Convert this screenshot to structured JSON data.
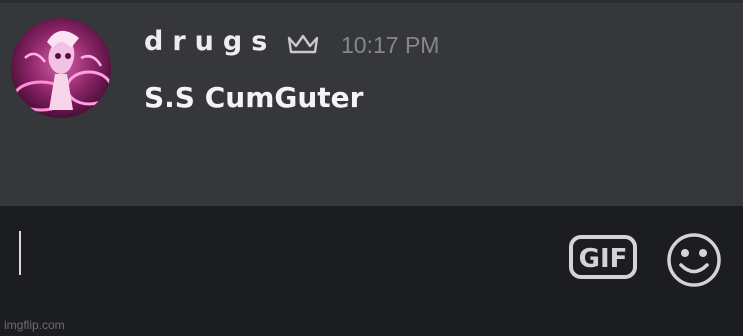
{
  "message": {
    "username": "drugs",
    "badge_icon": "crown-icon",
    "timestamp": "10:17 PM",
    "text": "S.S CumGuter",
    "avatar_icon": "avatar-image"
  },
  "composer": {
    "value": "",
    "gif_label": "GIF",
    "gif_icon": "gif-icon",
    "emoji_icon": "smiley-face-icon"
  },
  "watermark": "imgflip.com",
  "colors": {
    "chat_background": "#36373b",
    "composer_background": "#1c1d20",
    "username": "#ededf0",
    "timestamp": "#86878c",
    "message_text": "#f4f4f6",
    "icon": "#d4d4d8"
  }
}
